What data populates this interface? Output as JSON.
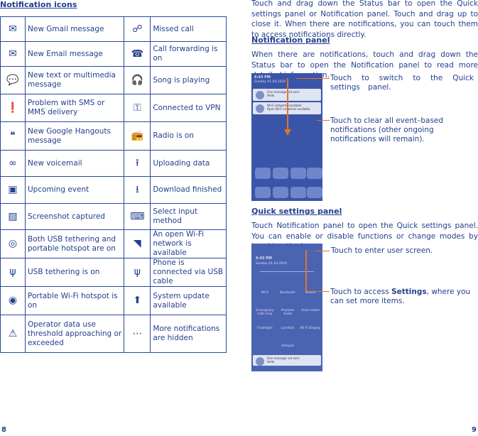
{
  "left": {
    "heading": "Notification icons",
    "rows": [
      [
        {
          "icon": "gmail-icon",
          "g": "✉",
          "text": "New Gmail message"
        },
        {
          "icon": "missed-call-icon",
          "g": "☍",
          "text": "Missed call"
        }
      ],
      [
        {
          "icon": "email-icon",
          "g": "✉",
          "text": "New Email message"
        },
        {
          "icon": "call-forwarding-icon",
          "g": "☎",
          "text": "Call forwarding is on"
        }
      ],
      [
        {
          "icon": "message-icon",
          "g": "💬",
          "text": "New text or multimedia message"
        },
        {
          "icon": "headphones-icon",
          "g": "🎧",
          "text": "Song is playing"
        }
      ],
      [
        {
          "icon": "sms-problem-icon",
          "g": "❗",
          "text": "Problem with SMS or MMS delivery"
        },
        {
          "icon": "vpn-key-icon",
          "g": "⚿",
          "text": "Connected to VPN"
        }
      ],
      [
        {
          "icon": "hangouts-icon",
          "g": "❝",
          "text": "New Google Hangouts message"
        },
        {
          "icon": "radio-icon",
          "g": "📻",
          "text": "Radio is on"
        }
      ],
      [
        {
          "icon": "voicemail-icon",
          "g": "∞",
          "text": "New voicemail"
        },
        {
          "icon": "upload-icon",
          "g": "⭱",
          "text": "Uploading data"
        }
      ],
      [
        {
          "icon": "calendar-icon",
          "g": "▣",
          "text": "Upcoming event"
        },
        {
          "icon": "download-icon",
          "g": "⭳",
          "text": "Download finished"
        }
      ],
      [
        {
          "icon": "screenshot-icon",
          "g": "▨",
          "text": "Screenshot captured"
        },
        {
          "icon": "keyboard-icon",
          "g": "⌨",
          "text": "Select input method"
        }
      ],
      [
        {
          "icon": "usb-hotspot-icon",
          "g": "◎",
          "text": "Both USB tethering and portable hotspot are on"
        },
        {
          "icon": "open-wifi-icon",
          "g": "◥",
          "text": "An open Wi-Fi network is available"
        }
      ],
      [
        {
          "icon": "usb-tethering-icon",
          "g": "ψ",
          "text": "USB tethering is on"
        },
        {
          "icon": "usb-icon",
          "g": "ψ",
          "text": "Phone is connected via USB cable"
        }
      ],
      [
        {
          "icon": "hotspot-icon",
          "g": "◉",
          "text": "Portable Wi-Fi hotspot is on"
        },
        {
          "icon": "system-update-icon",
          "g": "⬆",
          "text": "System update available"
        }
      ],
      [
        {
          "icon": "warning-icon",
          "g": "⚠",
          "text": "Operator data use threshold approaching or exceeded"
        },
        {
          "icon": "more-icon",
          "g": "⋯",
          "text": "More notifications are hidden"
        }
      ]
    ],
    "page_number": "8"
  },
  "right": {
    "intro": "Touch and drag down the Status bar to open the Quick settings panel or Notification panel. Touch and drag up to close it. When there are notifications, you can touch them to access notifications directly.",
    "notif_heading": "Notification panel",
    "notif_text": "When there are notifications, touch and drag down the Status bar to open the Notification panel to read more detailed information.",
    "notif_ann1": "Touch to switch to the Quick settings panel.",
    "notif_ann2": "Touch to clear all event–based notifications (other ongoing notifications will remain).",
    "qs_heading": "Quick settings panel",
    "qs_text": "Touch Notification panel to open the Quick settings panel. You can enable or disable functions or change modes by touching the icons.",
    "qs_ann1": "Touch to enter user screen.",
    "qs_ann2_pre": "Touch to access ",
    "qs_ann2_bold": "Settings",
    "qs_ann2_post": ", where you can set more items.",
    "phone": {
      "time": "6:43 PM",
      "date": "Sunday 01.04.2018",
      "card1": "One message not sent",
      "card1_sub": "Hello",
      "card1_time": "6:43 PM",
      "card2": "Wi-Fi networks available",
      "card2_sub": "Open Wi-Fi networks available",
      "qs_tiles": [
        "Wi-Fi",
        "Bluetooth",
        "Mobile",
        "Emergency calls only",
        "Airplane mode",
        "Auto-rotate",
        "Flashlight",
        "Location",
        "Wi-Fi Display",
        "Hotspot"
      ]
    },
    "page_number": "9"
  }
}
